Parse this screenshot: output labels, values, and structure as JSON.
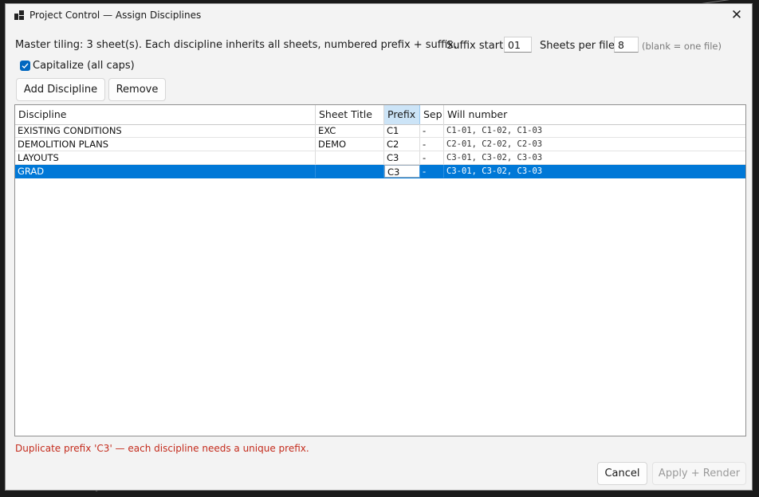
{
  "window": {
    "title": "Project Control — Assign Disciplines"
  },
  "summary": {
    "text": "Master tiling: 3 sheet(s). Each discipline inherits all sheets, numbered prefix + suffix."
  },
  "suffix_start": {
    "label": "Suffix start:",
    "value": "01"
  },
  "sheets_per_file": {
    "label": "Sheets per file:",
    "value": "8",
    "hint": "(blank = one file)"
  },
  "capitalize": {
    "label": "Capitalize (all caps)",
    "checked": true
  },
  "toolbar": {
    "add_label": "Add Discipline",
    "remove_label": "Remove"
  },
  "table": {
    "columns": [
      "Discipline",
      "Sheet Title",
      "Prefix",
      "Sep",
      "Will number"
    ],
    "rows": [
      {
        "discipline": "EXISTING CONDITIONS",
        "sheet_title": "EXC",
        "prefix": "C1",
        "sep": "-",
        "will_number": "C1-01, C1-02, C1-03"
      },
      {
        "discipline": "DEMOLITION PLANS",
        "sheet_title": "DEMO",
        "prefix": "C2",
        "sep": "-",
        "will_number": "C2-01, C2-02, C2-03"
      },
      {
        "discipline": "LAYOUTS",
        "sheet_title": "",
        "prefix": "C3",
        "sep": "-",
        "will_number": "C3-01, C3-02, C3-03"
      },
      {
        "discipline": "GRAD",
        "sheet_title": "",
        "prefix": "C3",
        "sep": "-",
        "will_number": "C3-01, C3-02, C3-03",
        "selected": true
      }
    ]
  },
  "error": {
    "text": "Duplicate prefix 'C3' — each discipline needs a unique prefix."
  },
  "footer": {
    "cancel_label": "Cancel",
    "apply_label": "Apply + Render"
  },
  "colors": {
    "accent": "#0078d7",
    "error": "#c42b1c"
  },
  "icons": {
    "app": "app-window-icon",
    "close": "close-icon",
    "check": "checkmark-icon"
  }
}
